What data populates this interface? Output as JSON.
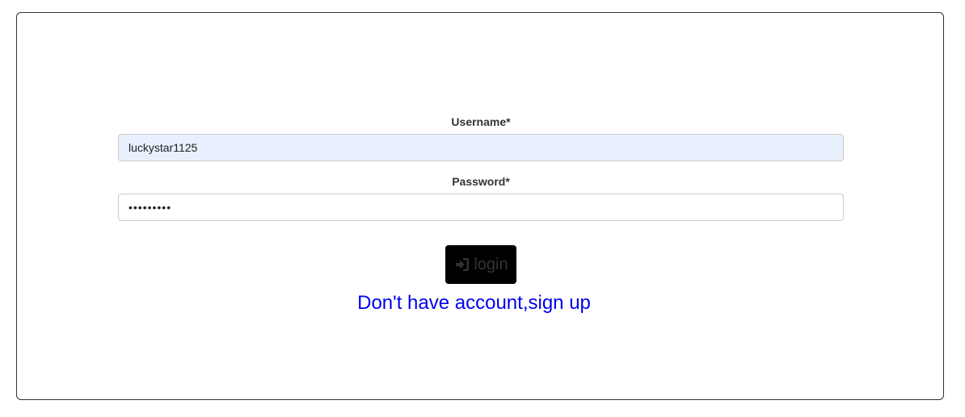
{
  "form": {
    "username_label": "Username*",
    "username_value": "luckystar1125",
    "password_label": "Password*",
    "password_value": "•••••••••",
    "login_label": "login",
    "login_icon": "sign-in-icon",
    "signup_link": "Don't have account,sign up"
  },
  "colors": {
    "autofill_bg": "#e8f0fe",
    "button_bg": "#000000",
    "link": "#0000ee",
    "border": "#333333"
  }
}
